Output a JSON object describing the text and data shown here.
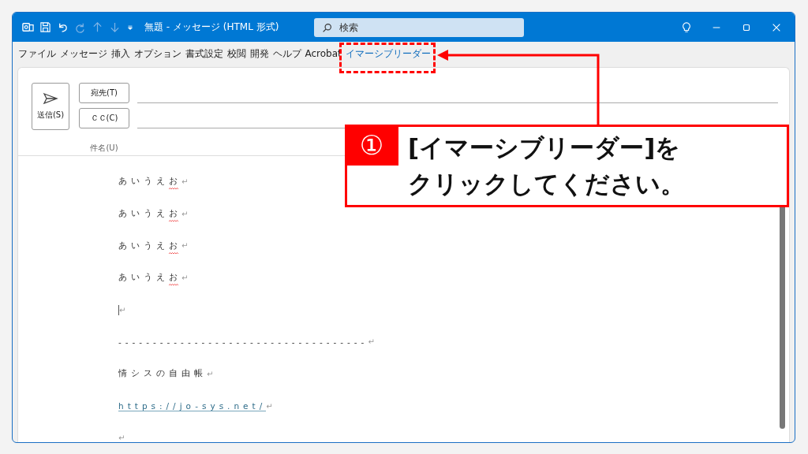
{
  "window": {
    "title": "無題 - メッセージ (HTML 形式)",
    "search_placeholder": "検索"
  },
  "quick_access": [
    {
      "kind": "app",
      "disabled": false
    },
    {
      "kind": "save",
      "disabled": false
    },
    {
      "kind": "undo",
      "disabled": false
    },
    {
      "kind": "redo",
      "disabled": true
    },
    {
      "kind": "up",
      "disabled": true
    },
    {
      "kind": "down",
      "disabled": true
    },
    {
      "kind": "customize",
      "disabled": false
    }
  ],
  "tabs": [
    {
      "label": "ファイル",
      "selected": false
    },
    {
      "label": "メッセージ",
      "selected": false
    },
    {
      "label": "挿入",
      "selected": false
    },
    {
      "label": "オプション",
      "selected": false
    },
    {
      "label": "書式設定",
      "selected": false
    },
    {
      "label": "校閲",
      "selected": false
    },
    {
      "label": "開発",
      "selected": false
    },
    {
      "label": "ヘルプ",
      "selected": false
    },
    {
      "label": "Acrobat",
      "selected": false
    },
    {
      "label": "イマーシブリーダー",
      "selected": true
    }
  ],
  "header": {
    "send": "送信(S)",
    "to": "宛先(T)",
    "cc": "ＣＣ(C)",
    "subject": "件名(U)"
  },
  "body": [
    {
      "kind": "text",
      "text": "あいうえお",
      "misspelled": true,
      "mark": "↵"
    },
    {
      "kind": "text",
      "text": "あいうえお",
      "misspelled": true,
      "mark": "↵"
    },
    {
      "kind": "text",
      "text": "あいうえお",
      "misspelled": true,
      "mark": "↵"
    },
    {
      "kind": "text",
      "text": "あいうえお",
      "misspelled": true,
      "mark": "↵"
    },
    {
      "kind": "cursor",
      "mark": "↵"
    },
    {
      "kind": "text",
      "text": "------------------------------------",
      "mark": "↵"
    },
    {
      "kind": "text",
      "text": "情シスの自由帳",
      "mark": "↵"
    },
    {
      "kind": "link",
      "text": "https://jo-sys.net/",
      "mark": "↵"
    },
    {
      "kind": "empty",
      "mark": "↵"
    }
  ],
  "callout": {
    "number": "①",
    "lines": [
      "[イマーシブリーダー]を",
      "クリックしてください。"
    ]
  }
}
